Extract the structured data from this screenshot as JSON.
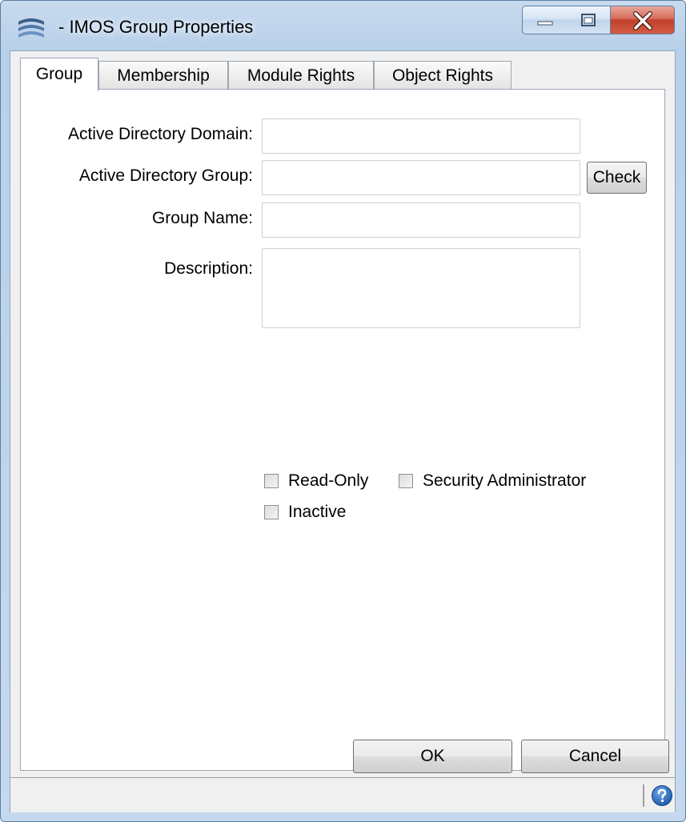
{
  "window": {
    "title": "- IMOS Group Properties"
  },
  "tabs": [
    {
      "label": "Group",
      "active": true
    },
    {
      "label": "Membership",
      "active": false
    },
    {
      "label": "Module Rights",
      "active": false
    },
    {
      "label": "Object Rights",
      "active": false
    }
  ],
  "form": {
    "ad_domain": {
      "label": "Active Directory Domain:",
      "value": ""
    },
    "ad_group": {
      "label": "Active Directory Group:",
      "value": "",
      "button": "Check"
    },
    "group_name": {
      "label": "Group Name:",
      "value": ""
    },
    "description": {
      "label": "Description:",
      "value": ""
    }
  },
  "checkboxes": {
    "read_only": {
      "label": "Read-Only",
      "checked": false
    },
    "security_admin": {
      "label": "Security Administrator",
      "checked": false
    },
    "inactive": {
      "label": "Inactive",
      "checked": false
    }
  },
  "buttons": {
    "ok": "OK",
    "cancel": "Cancel"
  },
  "icons": {
    "app": "imos-app-icon",
    "minimize": "minimize-icon",
    "maximize": "maximize-icon",
    "close": "close-icon",
    "help": "help-icon"
  },
  "colors": {
    "close_button": "#c0402b",
    "help_icon": "#1f5fae",
    "title_bar": "#b9d0ea"
  }
}
